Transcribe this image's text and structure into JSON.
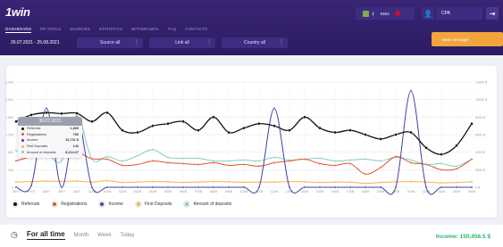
{
  "app": {
    "logo": "1win",
    "nav": [
      "DASHBOARD",
      "PR TOOLS",
      "SOURCES",
      "STATISTICS",
      "WITHDRAWAL",
      "FAQ",
      "CONTACTS"
    ],
    "date_range": "26.07.2021 - 25.08.2021",
    "filters": {
      "source": "Source all",
      "link": "Link all",
      "country": "Country all"
    },
    "lang": "ENG",
    "account_type": "CPA",
    "message_button": "New message!"
  },
  "colors": {
    "referrals": "#111111",
    "registrations": "#e0532c",
    "income": "#3f3fa8",
    "first_deposits": "#f1b440",
    "amount_deposits": "#7fcfbf",
    "income_text": "#2bb36e",
    "accent": "#f1a53b"
  },
  "tooltip": {
    "date": "30.07.2021",
    "rows": [
      {
        "label": "Referrals",
        "value": "1,689"
      },
      {
        "label": "Registrations",
        "value": "796"
      },
      {
        "label": "Income",
        "value": "16,731 $"
      },
      {
        "label": "First Deposits",
        "value": "140"
      },
      {
        "label": "Amount of deposits",
        "value": "8,214.37"
      }
    ]
  },
  "legend": [
    "Referrals",
    "Registrations",
    "Income",
    "First Deposits",
    "Amount of deposits"
  ],
  "footer": {
    "tabs": [
      "For all time",
      "Month",
      "Week",
      "Today"
    ],
    "income_label": "Income: 150,456.5 $"
  },
  "chart_data": {
    "type": "line",
    "left_axis": {
      "ylim": [
        0,
        2400
      ],
      "ticks": [
        0,
        400,
        800,
        1200,
        1600,
        2000,
        2400
      ]
    },
    "right_axis": {
      "ylim": [
        0,
        12000
      ],
      "ticks": [
        "0 $",
        "2000 $",
        "4000 $",
        "6000 $",
        "8000 $",
        "10000 $",
        "12000 $"
      ]
    },
    "x": [
      "26/07",
      "27/07",
      "28/07",
      "29/07",
      "30/07",
      "31/07",
      "01/08",
      "02/08",
      "03/08",
      "04/08",
      "05/08",
      "06/08",
      "07/08",
      "08/08",
      "09/08",
      "10/08",
      "11/08",
      "12/08",
      "13/08",
      "14/08",
      "15/08",
      "16/08",
      "17/08",
      "18/08",
      "19/08",
      "20/08",
      "21/08",
      "22/08",
      "23/08",
      "24/08",
      "25/08"
    ],
    "series": [
      {
        "name": "Referrals",
        "axis": "left",
        "values": [
          1500,
          1650,
          1700,
          1680,
          1689,
          1500,
          1700,
          1300,
          1250,
          1400,
          1450,
          1500,
          1300,
          1600,
          1250,
          1350,
          1450,
          1400,
          1300,
          1600,
          1350,
          1250,
          1300,
          1200,
          1100,
          1200,
          1250,
          900,
          750,
          950,
          1450
        ]
      },
      {
        "name": "Registrations",
        "axis": "left",
        "values": [
          600,
          700,
          750,
          720,
          796,
          650,
          640,
          500,
          520,
          600,
          560,
          540,
          520,
          560,
          500,
          520,
          480,
          560,
          600,
          640,
          540,
          500,
          540,
          300,
          450,
          700,
          560,
          520,
          400,
          420,
          640
        ]
      },
      {
        "name": "Income",
        "axis": "right",
        "values": [
          0,
          200,
          9000,
          0,
          8000,
          0,
          0,
          0,
          0,
          0,
          0,
          0,
          0,
          0,
          0,
          0,
          0,
          9000,
          0,
          0,
          0,
          0,
          0,
          0,
          0,
          0,
          11000,
          0,
          0,
          0,
          0
        ]
      },
      {
        "name": "First Deposits",
        "axis": "left",
        "values": [
          120,
          130,
          140,
          135,
          140,
          120,
          150,
          110,
          120,
          130,
          125,
          110,
          120,
          130,
          125,
          115,
          120,
          118,
          130,
          125,
          110,
          120,
          115,
          90,
          110,
          125,
          130,
          120,
          100,
          110,
          125
        ]
      },
      {
        "name": "Amount of deposits",
        "axis": "right",
        "values": [
          4200,
          3500,
          3800,
          3000,
          8214,
          3200,
          3500,
          3000,
          3600,
          4300,
          3400,
          3300,
          3300,
          3000,
          3000,
          3100,
          3000,
          3400,
          3100,
          3200,
          3300,
          3000,
          3100,
          3200,
          3000,
          3400,
          3100,
          2600,
          2700,
          2400,
          3200
        ]
      }
    ]
  }
}
